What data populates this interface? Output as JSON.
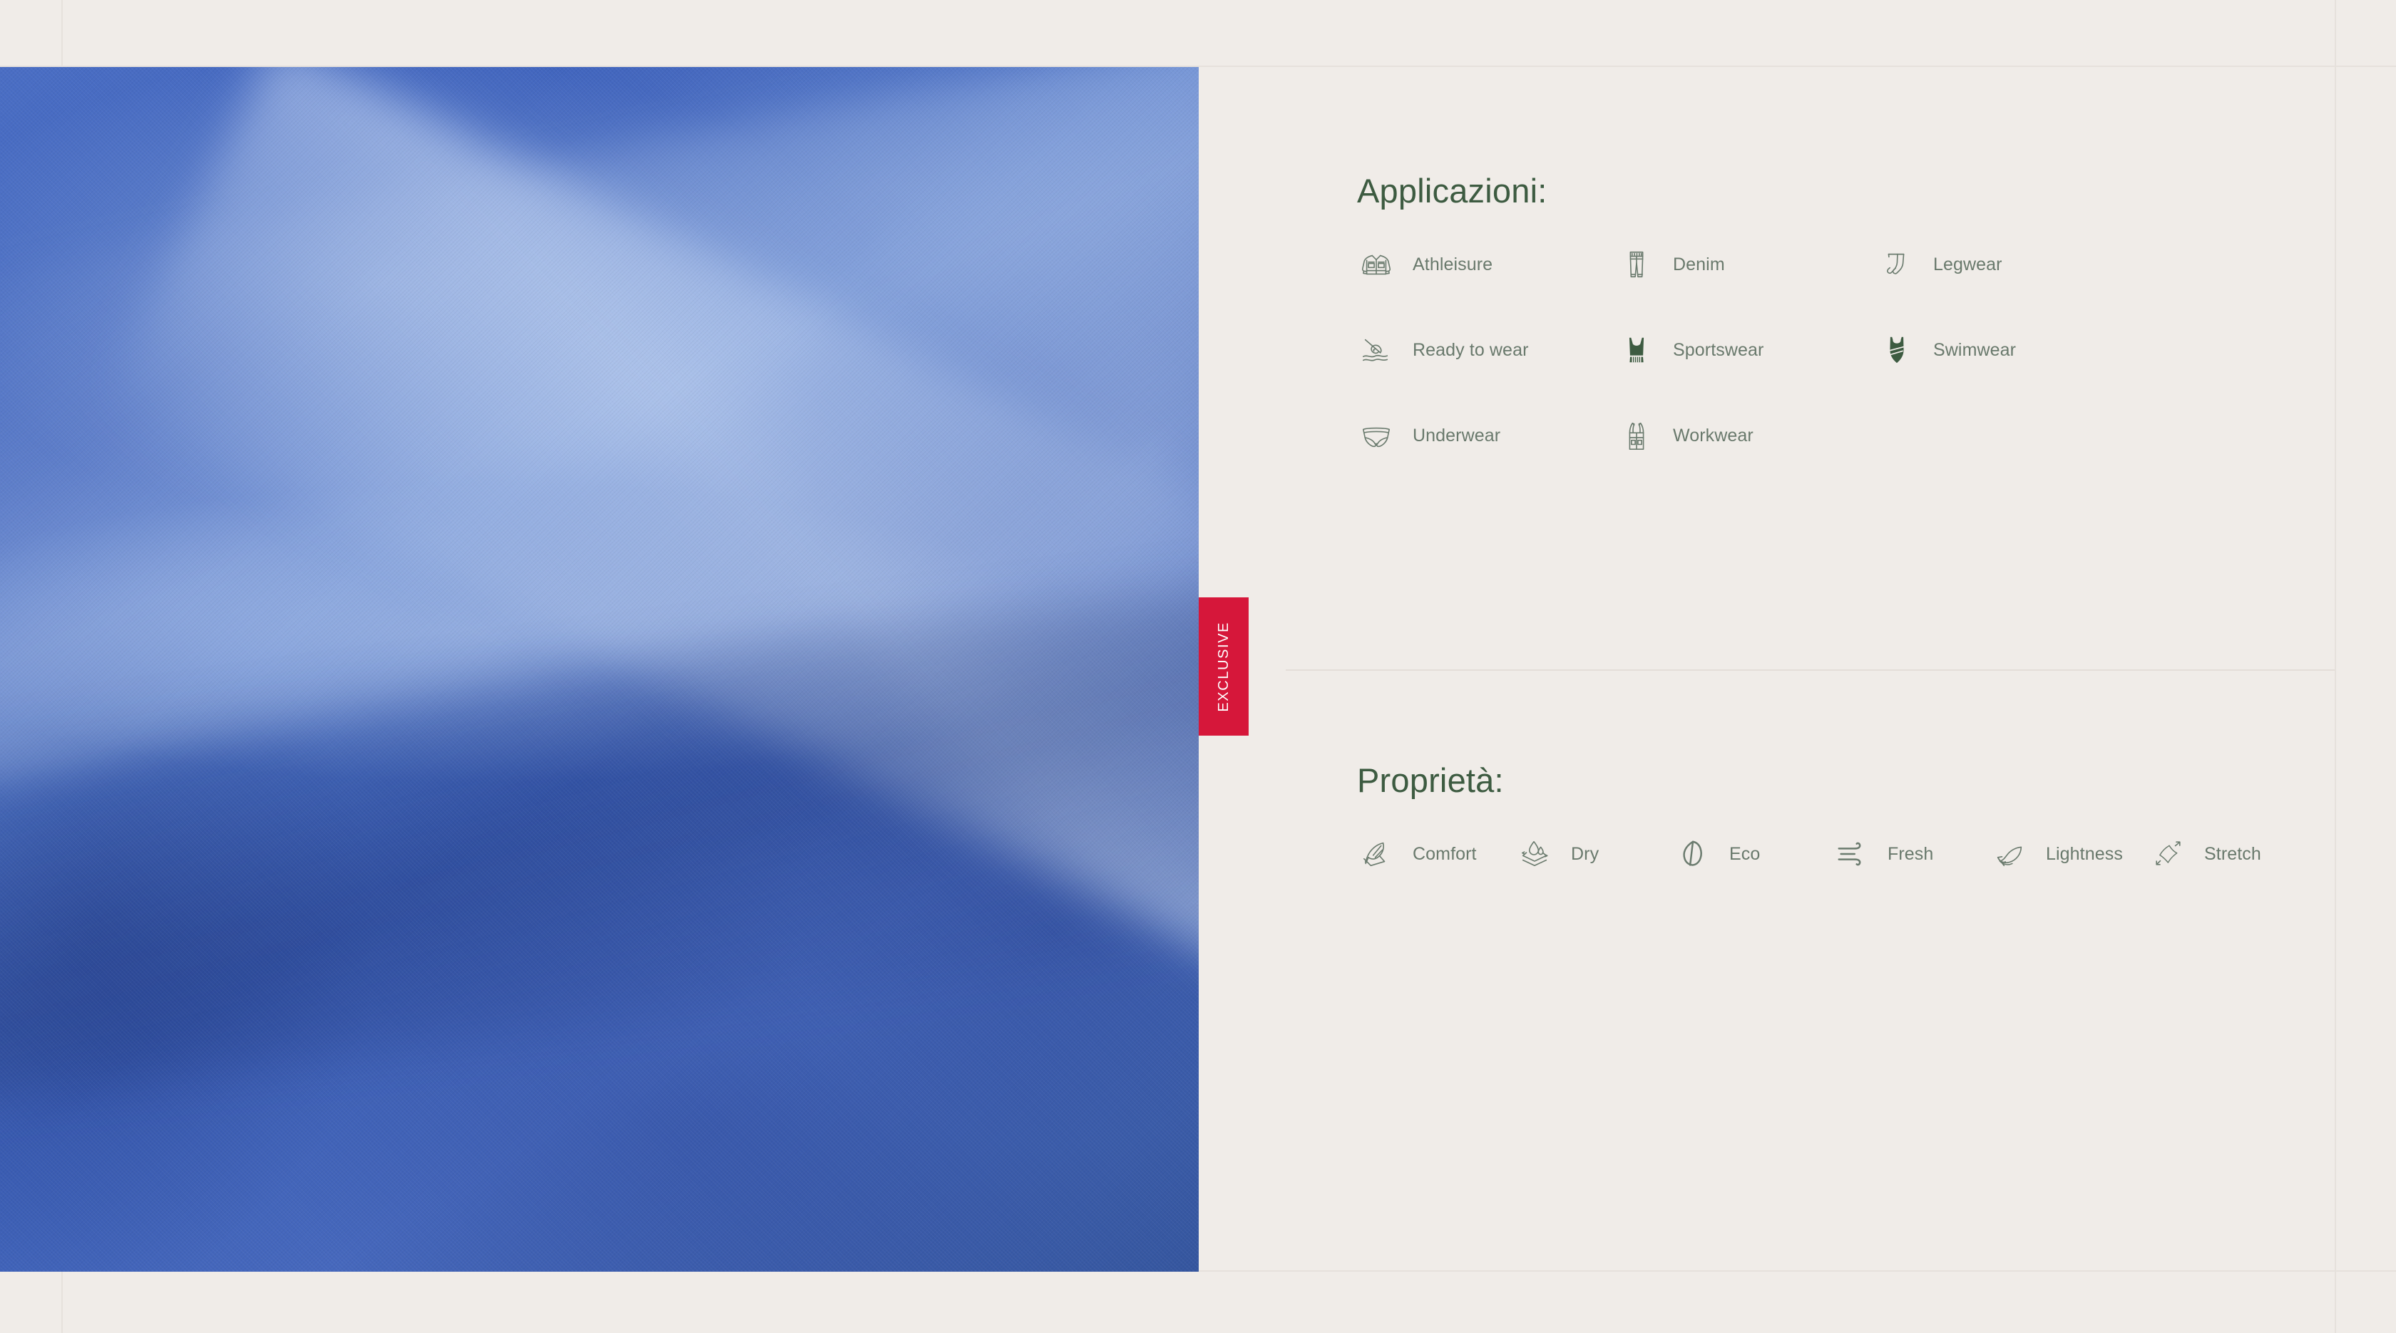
{
  "theme": {
    "background": "#f0ece8",
    "heading_color": "#3d5b41",
    "label_color": "#69796c",
    "icon_stroke": "#6b7b6e",
    "badge_background": "#d6173a",
    "badge_text_color": "#ffffff",
    "rule_color": "#e6e1dc",
    "fabric_blue": "#3f63b8"
  },
  "badge": {
    "label": "EXCLUSIVE"
  },
  "media": {
    "alt": "blue draped technical fabric swatch"
  },
  "sections": [
    {
      "id": "applications",
      "title": "Applicazioni:",
      "items": [
        {
          "label": "Athleisure",
          "icon": "jacket-icon"
        },
        {
          "label": "Denim",
          "icon": "jeans-icon"
        },
        {
          "label": "Legwear",
          "icon": "stockings-icon"
        },
        {
          "label": "Ready to wear",
          "icon": "needle-thread-icon"
        },
        {
          "label": "Sportswear",
          "icon": "tank-top-icon"
        },
        {
          "label": "Swimwear",
          "icon": "swimsuit-icon"
        },
        {
          "label": "Underwear",
          "icon": "briefs-icon"
        },
        {
          "label": "Workwear",
          "icon": "overalls-icon"
        }
      ]
    },
    {
      "id": "properties",
      "title": "Proprietà:",
      "items": [
        {
          "label": "Comfort",
          "icon": "feather-icon"
        },
        {
          "label": "Dry",
          "icon": "water-droplet-layers-icon"
        },
        {
          "label": "Eco",
          "icon": "leaf-icon"
        },
        {
          "label": "Fresh",
          "icon": "wind-icon"
        },
        {
          "label": "Lightness",
          "icon": "feather-light-icon"
        },
        {
          "label": "Stretch",
          "icon": "stretch-arrows-icon"
        }
      ]
    }
  ]
}
